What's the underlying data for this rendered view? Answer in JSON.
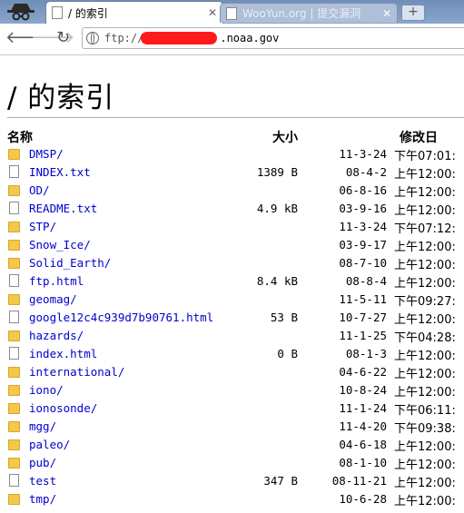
{
  "browser": {
    "tabs": [
      {
        "label": "/ 的索引",
        "active": true
      },
      {
        "label": "WooYun.org | 提交漏洞",
        "active": false
      }
    ],
    "new_tab": "+",
    "url_prefix": "ftp://",
    "url_host": ".noaa.gov"
  },
  "page": {
    "title": "/ 的索引",
    "columns": {
      "name": "名称",
      "size": "大小",
      "date": "修改日"
    },
    "rows": [
      {
        "name": "DMSP/",
        "size": "",
        "date": "11-3-24",
        "time": "下午07:01:",
        "type": "folder"
      },
      {
        "name": "INDEX.txt",
        "size": "1389 B",
        "date": "08-4-2",
        "time": "上午12:00:",
        "type": "file"
      },
      {
        "name": "OD/",
        "size": "",
        "date": "06-8-16",
        "time": "上午12:00:",
        "type": "folder"
      },
      {
        "name": "README.txt",
        "size": "4.9 kB",
        "date": "03-9-16",
        "time": "上午12:00:",
        "type": "file"
      },
      {
        "name": "STP/",
        "size": "",
        "date": "11-3-24",
        "time": "下午07:12:",
        "type": "folder"
      },
      {
        "name": "Snow_Ice/",
        "size": "",
        "date": "03-9-17",
        "time": "上午12:00:",
        "type": "folder"
      },
      {
        "name": "Solid_Earth/",
        "size": "",
        "date": "08-7-10",
        "time": "上午12:00:",
        "type": "folder"
      },
      {
        "name": "ftp.html",
        "size": "8.4 kB",
        "date": "08-8-4",
        "time": "上午12:00:",
        "type": "file"
      },
      {
        "name": "geomag/",
        "size": "",
        "date": "11-5-11",
        "time": "下午09:27:",
        "type": "folder"
      },
      {
        "name": "google12c4c939d7b90761.html",
        "size": "53 B",
        "date": "10-7-27",
        "time": "上午12:00:",
        "type": "file"
      },
      {
        "name": "hazards/",
        "size": "",
        "date": "11-1-25",
        "time": "下午04:28:",
        "type": "folder"
      },
      {
        "name": "index.html",
        "size": "0 B",
        "date": "08-1-3",
        "time": "上午12:00:",
        "type": "file"
      },
      {
        "name": "international/",
        "size": "",
        "date": "04-6-22",
        "time": "上午12:00:",
        "type": "folder"
      },
      {
        "name": "iono/",
        "size": "",
        "date": "10-8-24",
        "time": "上午12:00:",
        "type": "folder"
      },
      {
        "name": "ionosonde/",
        "size": "",
        "date": "11-1-24",
        "time": "下午06:11:",
        "type": "folder"
      },
      {
        "name": "mgg/",
        "size": "",
        "date": "11-4-20",
        "time": "下午09:38:",
        "type": "folder"
      },
      {
        "name": "paleo/",
        "size": "",
        "date": "04-6-18",
        "time": "上午12:00:",
        "type": "folder"
      },
      {
        "name": "pub/",
        "size": "",
        "date": "08-1-10",
        "time": "上午12:00:",
        "type": "folder"
      },
      {
        "name": "test",
        "size": "347 B",
        "date": "08-11-21",
        "time": "上午12:00:",
        "type": "file"
      },
      {
        "name": "tmp/",
        "size": "",
        "date": "10-6-28",
        "time": "上午12:00:",
        "type": "folder"
      }
    ]
  },
  "icons": {
    "incognito": "incognito-icon",
    "back": "back-arrow-icon",
    "forward": "forward-arrow-icon",
    "reload": "reload-icon",
    "globe": "globe-icon",
    "folder": "folder-icon",
    "file": "file-icon"
  },
  "colors": {
    "link": "#0000cc",
    "tabstrip": "#7b98c2",
    "redaction": "#ff1b1b",
    "folder": "#f4c94a"
  }
}
